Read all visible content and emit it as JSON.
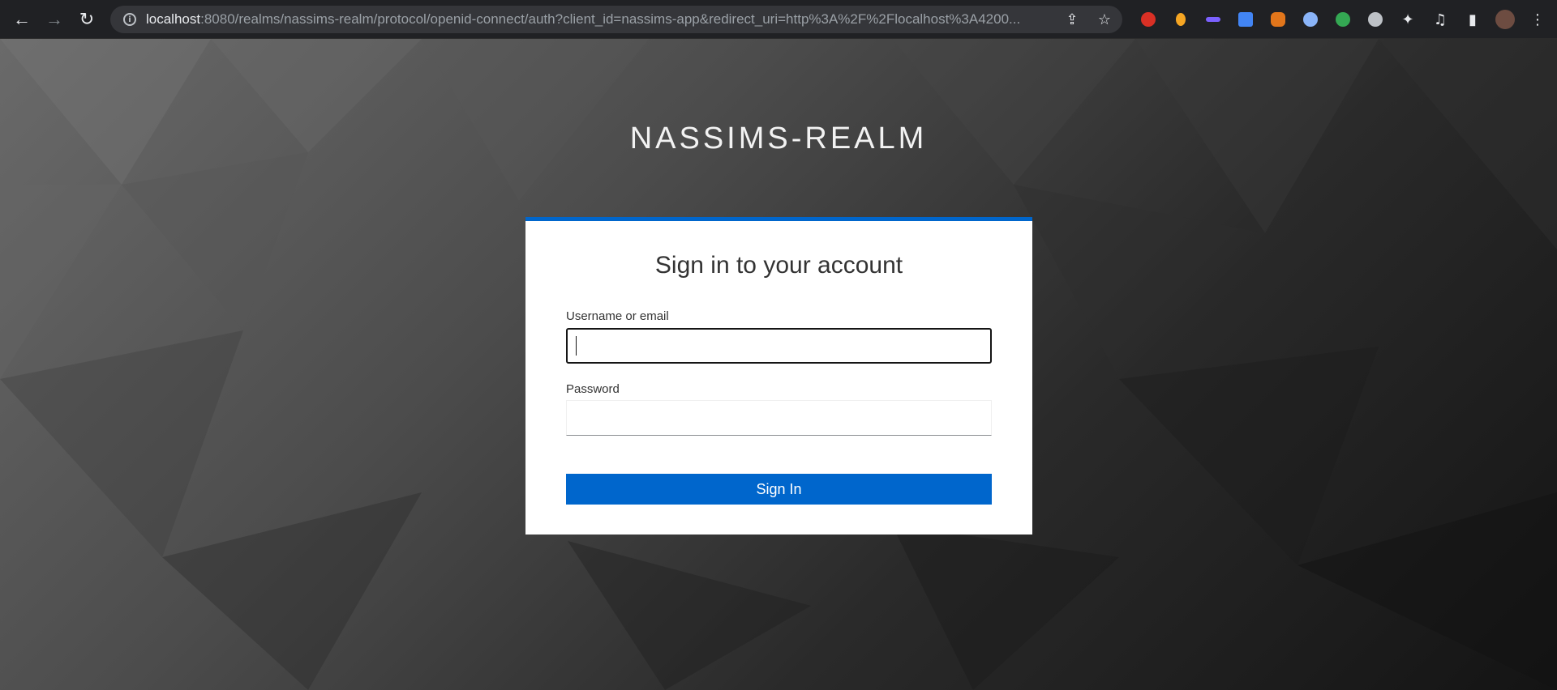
{
  "browser": {
    "url_host": "localhost",
    "url_rest": ":8080/realms/nassims-realm/protocol/openid-connect/auth?client_id=nassims-app&redirect_uri=http%3A%2F%2Flocalhost%3A4200...",
    "back_glyph": "←",
    "forward_glyph": "→",
    "reload_glyph": "↻",
    "info_glyph": "i",
    "share_glyph": "⇪",
    "star_glyph": "☆",
    "extensions": [
      {
        "name": "adblock-icon",
        "color": "#d93025"
      },
      {
        "name": "extension-orange-icon",
        "color": "#f6a623"
      },
      {
        "name": "link-extension-icon",
        "color": "#7b61ff"
      },
      {
        "name": "translate-icon",
        "color": "#4285f4"
      },
      {
        "name": "metamask-icon",
        "color": "#e2761b"
      },
      {
        "name": "gear-extension-icon",
        "color": "#8ab4f8"
      },
      {
        "name": "colorful-extension-icon",
        "color": "#34a853"
      },
      {
        "name": "hex-extension-icon",
        "color": "#bdc1c6"
      }
    ],
    "puzzle_glyph": "✦",
    "media_glyph": "♫",
    "sidepanel_glyph": "▮",
    "menu_glyph": "⋮"
  },
  "realm": {
    "title": "NASSIMS-REALM"
  },
  "login": {
    "heading": "Sign in to your account",
    "username_label": "Username or email",
    "username_value": "",
    "password_label": "Password",
    "password_value": "",
    "submit_label": "Sign In"
  },
  "colors": {
    "accent": "#0066cc",
    "page_bg": "#2a2a2a"
  }
}
